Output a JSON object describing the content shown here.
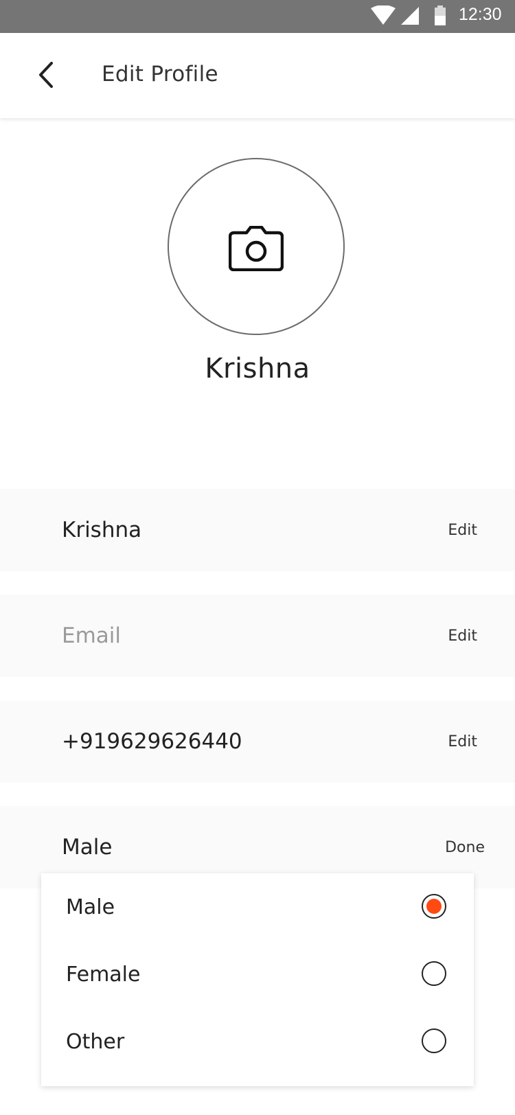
{
  "status_bar": {
    "time": "12:30",
    "icons": [
      "wifi-icon",
      "signal-icon",
      "battery-icon"
    ]
  },
  "header": {
    "title": "Edit Profile",
    "back_icon": "chevron-left-icon"
  },
  "profile": {
    "avatar_icon": "camera-icon",
    "name": "Krishna"
  },
  "fields": [
    {
      "value": "Krishna",
      "placeholder": "",
      "action": "Edit"
    },
    {
      "value": "",
      "placeholder": "Email",
      "action": "Edit"
    },
    {
      "value": "+919629626440",
      "placeholder": "",
      "action": "Edit"
    },
    {
      "value": "Male",
      "placeholder": "",
      "action": "Done"
    }
  ],
  "gender_dropdown": {
    "selected": "Male",
    "options": [
      "Male",
      "Female",
      "Other"
    ]
  },
  "colors": {
    "accent": "#ff4a12",
    "status_bar": "#757575",
    "row_background": "#fafafa"
  }
}
